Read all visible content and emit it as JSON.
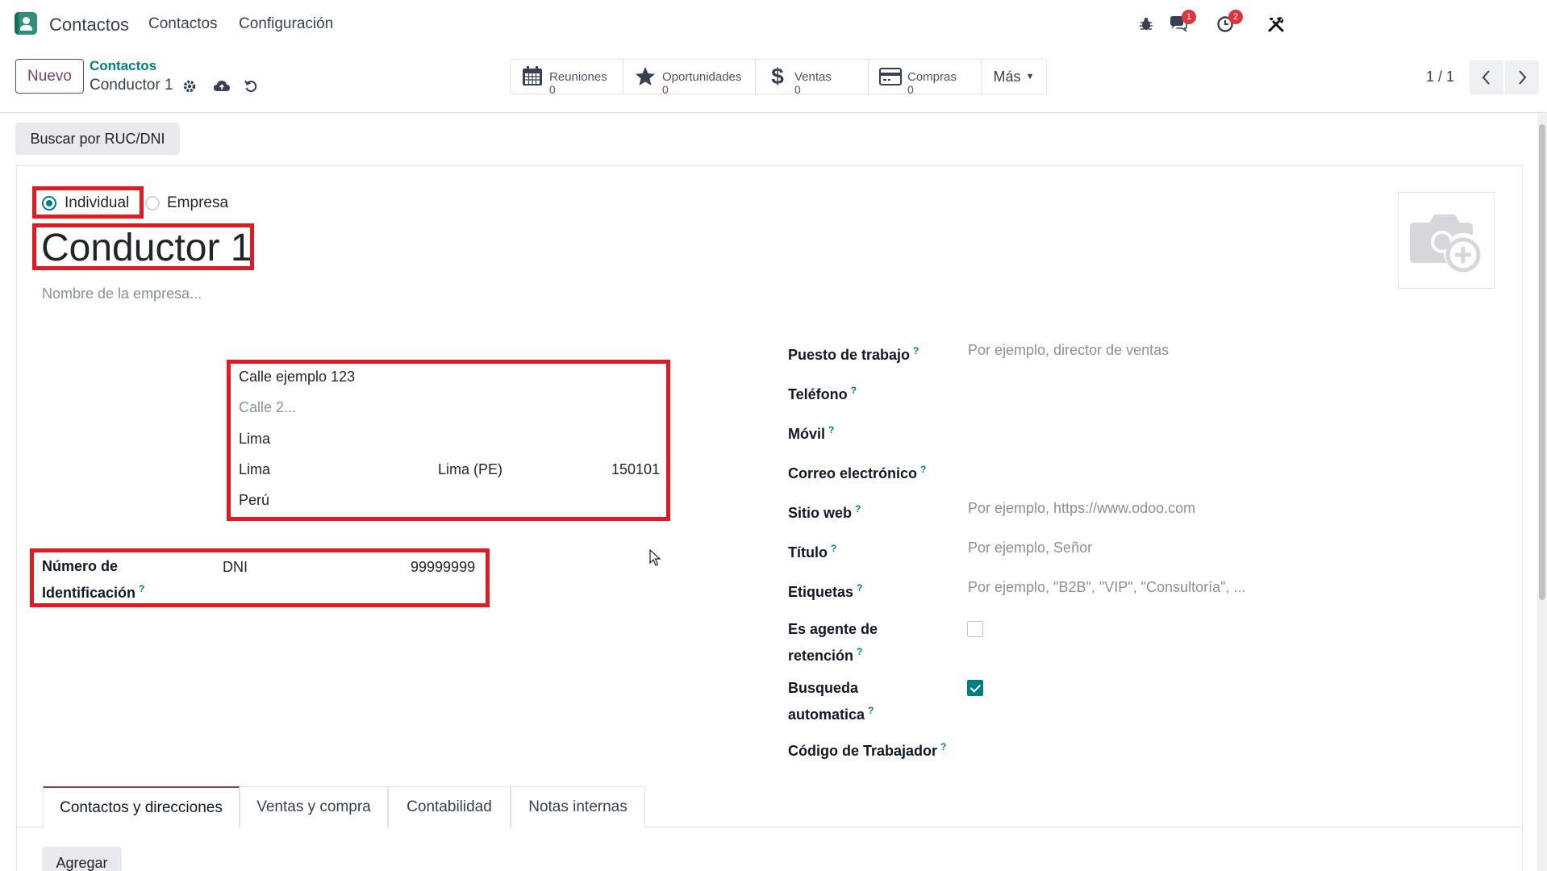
{
  "navbar": {
    "app_name": "Contactos",
    "menu": [
      "Contactos",
      "Configuración"
    ],
    "icons": {
      "debug": "bug-icon",
      "chat": "chat-bubbles-icon",
      "activity": "clock-icon",
      "tools": "tools-icon"
    },
    "chat_badge": "1",
    "activity_badge": "2"
  },
  "control_panel": {
    "new_button": "Nuevo",
    "breadcrumb_parent": "Contactos",
    "breadcrumb_current": "Conductor 1",
    "smart_buttons": [
      {
        "label": "Reuniones",
        "value": "0",
        "icon": "calendar-icon"
      },
      {
        "label": "Oportunidades",
        "value": "0",
        "icon": "star-icon"
      },
      {
        "label": "Ventas",
        "value": "0",
        "icon": "dollar-icon"
      },
      {
        "label": "Compras",
        "value": "0",
        "icon": "credit-card-icon"
      }
    ],
    "more_button": "Más",
    "pager": "1 / 1"
  },
  "form": {
    "search_button": "Buscar por RUC/DNI",
    "type_options": [
      "Individual",
      "Empresa"
    ],
    "type_selected": "Individual",
    "name": "Conductor 1",
    "company_placeholder": "Nombre de la empresa...",
    "address": {
      "street": "Calle ejemplo 123",
      "street2_placeholder": "Calle 2...",
      "district": "Lima",
      "city": "Lima",
      "state": "Lima (PE)",
      "zip": "150101",
      "country": "Perú"
    },
    "identification": {
      "label_line1": "Número de",
      "label_line2": "Identificación",
      "type": "DNI",
      "number": "99999999"
    },
    "right_fields": [
      {
        "label": "Puesto de trabajo",
        "value": "",
        "placeholder": "Por ejemplo, director de ventas"
      },
      {
        "label": "Teléfono",
        "value": "",
        "placeholder": ""
      },
      {
        "label": "Móvil",
        "value": "",
        "placeholder": ""
      },
      {
        "label": "Correo electrónico",
        "value": "",
        "placeholder": ""
      },
      {
        "label": "Sitio web",
        "value": "",
        "placeholder": "Por ejemplo, https://www.odoo.com"
      },
      {
        "label": "Título",
        "value": "",
        "placeholder": "Por ejemplo, Señor"
      },
      {
        "label": "Etiquetas",
        "value": "",
        "placeholder": "Por ejemplo, \"B2B\", \"VIP\", \"Consultoría\", ..."
      }
    ],
    "retention_agent": {
      "label_line1": "Es agente de",
      "label_line2": "retención",
      "checked": false
    },
    "auto_search": {
      "label_line1": "Busqueda",
      "label_line2": "automatica",
      "checked": true
    },
    "worker_code": {
      "label": "Código de Trabajador"
    },
    "help_mark": "?"
  },
  "tabs": {
    "items": [
      "Contactos y direcciones",
      "Ventas y compra",
      "Contabilidad",
      "Notas internas"
    ],
    "active": "Contactos y direcciones"
  },
  "add_button": "Agregar",
  "colors": {
    "accent": "#017e84",
    "brand": "#7c4164",
    "highlight": "#e01b24"
  }
}
